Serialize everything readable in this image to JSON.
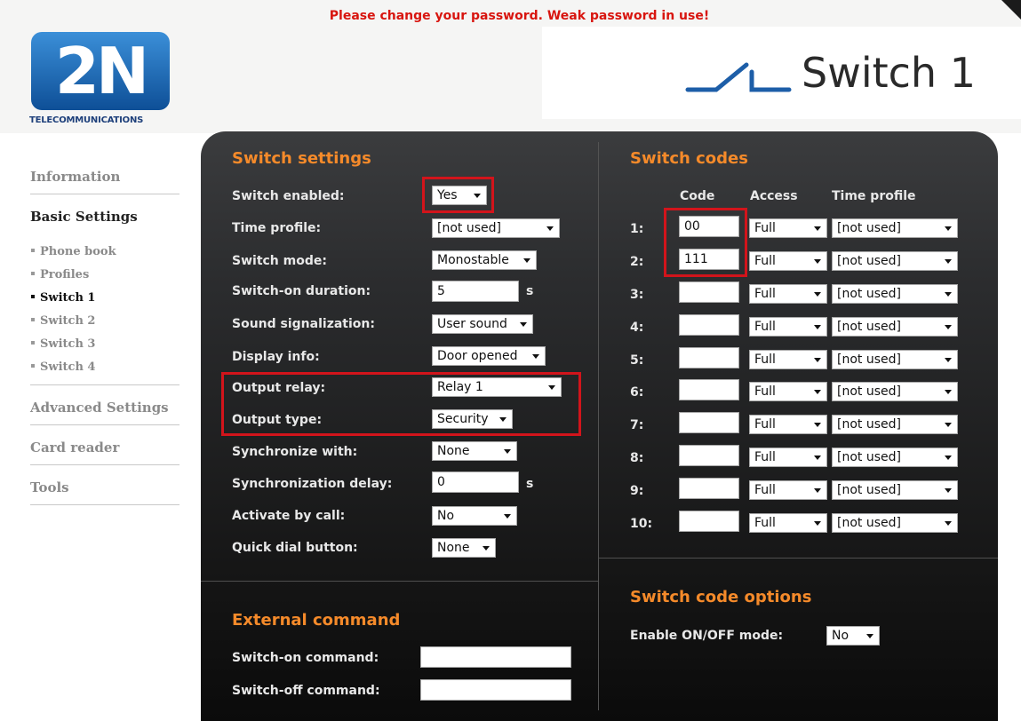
{
  "warning": "Please change your password. Weak password in use!",
  "logo": {
    "glyph": "2N",
    "subtitle": "TELECOMMUNICATIONS"
  },
  "page_title": "Switch 1",
  "sidebar": {
    "information": "Information",
    "basic_settings": "Basic Settings",
    "sub": [
      "Phone book",
      "Profiles",
      "Switch 1",
      "Switch 2",
      "Switch 3",
      "Switch 4"
    ],
    "advanced_settings": "Advanced Settings",
    "card_reader": "Card reader",
    "tools": "Tools"
  },
  "switch_settings": {
    "title": "Switch settings",
    "rows": [
      {
        "label": "Switch enabled:",
        "value": "Yes"
      },
      {
        "label": "Time profile:",
        "value": "[not used]"
      },
      {
        "label": "Switch mode:",
        "value": "Monostable"
      },
      {
        "label": "Switch-on duration:",
        "value": "5",
        "unit": "s"
      },
      {
        "label": "Sound signalization:",
        "value": "User sound"
      },
      {
        "label": "Display info:",
        "value": "Door opened"
      },
      {
        "label": "Output relay:",
        "value": "Relay 1"
      },
      {
        "label": "Output type:",
        "value": "Security"
      },
      {
        "label": "Synchronize with:",
        "value": "None"
      },
      {
        "label": "Synchronization delay:",
        "value": "0",
        "unit": "s"
      },
      {
        "label": "Activate by call:",
        "value": "No"
      },
      {
        "label": "Quick dial button:",
        "value": "None"
      }
    ]
  },
  "external_command": {
    "title": "External command",
    "on_label": "Switch-on command:",
    "off_label": "Switch-off command:",
    "on_value": "",
    "off_value": ""
  },
  "switch_codes": {
    "title": "Switch codes",
    "headers": {
      "code": "Code",
      "access": "Access",
      "time_profile": "Time profile"
    },
    "rows": [
      {
        "num": "1:",
        "code": "00",
        "access": "Full",
        "profile": "[not used]"
      },
      {
        "num": "2:",
        "code": "111",
        "access": "Full",
        "profile": "[not used]"
      },
      {
        "num": "3:",
        "code": "",
        "access": "Full",
        "profile": "[not used]"
      },
      {
        "num": "4:",
        "code": "",
        "access": "Full",
        "profile": "[not used]"
      },
      {
        "num": "5:",
        "code": "",
        "access": "Full",
        "profile": "[not used]"
      },
      {
        "num": "6:",
        "code": "",
        "access": "Full",
        "profile": "[not used]"
      },
      {
        "num": "7:",
        "code": "",
        "access": "Full",
        "profile": "[not used]"
      },
      {
        "num": "8:",
        "code": "",
        "access": "Full",
        "profile": "[not used]"
      },
      {
        "num": "9:",
        "code": "",
        "access": "Full",
        "profile": "[not used]"
      },
      {
        "num": "10:",
        "code": "",
        "access": "Full",
        "profile": "[not used]"
      }
    ]
  },
  "code_options": {
    "title": "Switch code options",
    "label": "Enable ON/OFF mode:",
    "value": "No"
  },
  "colors": {
    "accent": "#f58a2a",
    "highlight": "#d2141b",
    "warning": "#d8150f",
    "panel": "#2c2d2f"
  }
}
